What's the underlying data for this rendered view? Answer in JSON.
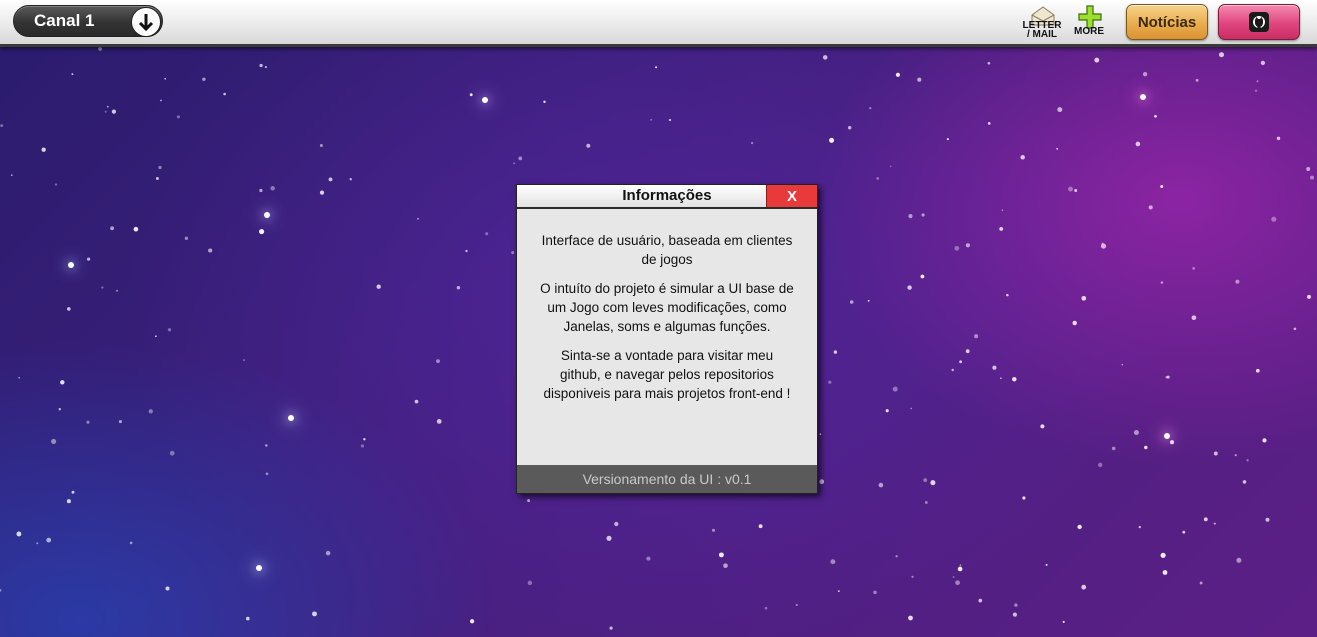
{
  "topbar": {
    "channel_label": "Canal 1",
    "channel_dropdown_icon": "arrow-down-icon",
    "letter_mail_caption_line1": "LETTER",
    "letter_mail_caption_line2": "/ MAIL",
    "more_caption": "MORE",
    "news_label": "Notícias",
    "github_icon": "github-icon"
  },
  "modal": {
    "title": "Informações",
    "close_label": "X",
    "paragraphs": [
      "Interface de usuário, baseada em clientes de jogos",
      "O intuíto do projeto é simular a UI base de um Jogo com leves modificações, como Janelas, soms e algumas funções.",
      "Sinta-se a vontade para visitar meu github, e navegar pelos repositorios disponiveis para mais projetos front-end !"
    ],
    "footer": "Versionamento da UI : v0.1"
  },
  "colors": {
    "close_button": "#e83a3a",
    "news_button": "#e9ad4e",
    "github_button": "#e0467e",
    "footer_bg": "#5a5a5a"
  }
}
